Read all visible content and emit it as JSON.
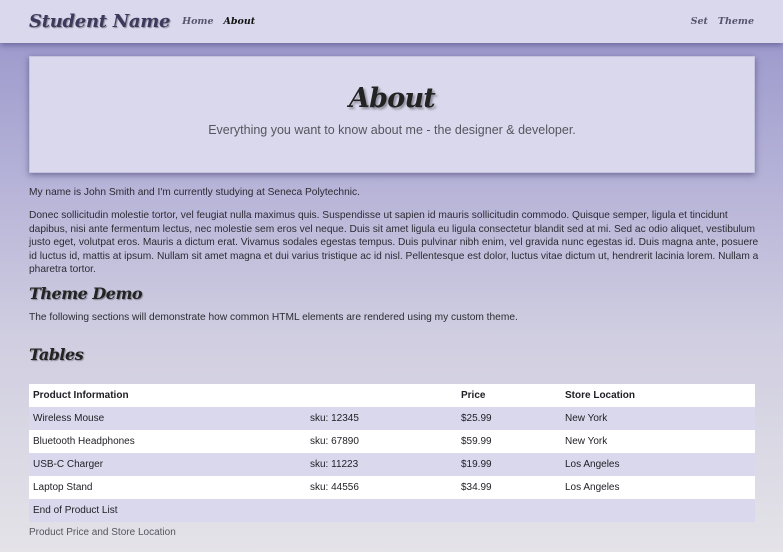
{
  "navbar": {
    "brand": "Student Name",
    "links": [
      {
        "label": "Home",
        "active": false
      },
      {
        "label": "About",
        "active": true
      }
    ],
    "right_links": [
      {
        "label": "Set"
      },
      {
        "label": "Theme"
      }
    ]
  },
  "jumbotron": {
    "title": "About",
    "lead": "Everything you want to know about me - the designer & developer."
  },
  "content": {
    "intro": "My name is John Smith and I'm currently studying at Seneca Polytechnic.",
    "paragraph": "Donec sollicitudin molestie tortor, vel feugiat nulla maximus quis. Suspendisse ut sapien id mauris sollicitudin commodo. Quisque semper, ligula et tincidunt dapibus, nisi ante fermentum lectus, nec molestie sem eros vel neque. Duis sit amet ligula eu ligula consectetur blandit sed at mi. Sed ac odio aliquet, vestibulum justo eget, volutpat eros. Mauris a dictum erat. Vivamus sodales egestas tempus. Duis pulvinar nibh enim, vel gravida nunc egestas id. Duis magna ante, posuere id luctus id, mattis at ipsum. Nullam sit amet magna et dui varius tristique ac id nisl. Pellentesque est dolor, luctus vitae dictum ut, hendrerit lacinia lorem. Nullam a pharetra tortor.",
    "theme_heading": "Theme Demo",
    "theme_desc": "The following sections will demonstrate how common HTML elements are rendered using my custom theme.",
    "tables_heading": "Tables"
  },
  "table": {
    "headers": [
      "Product Information",
      "",
      "Price",
      "Store Location"
    ],
    "rows": [
      [
        "Wireless Mouse",
        "sku: 12345",
        "$25.99",
        "New York"
      ],
      [
        "Bluetooth Headphones",
        "sku: 67890",
        "$59.99",
        "New York"
      ],
      [
        "USB-C Charger",
        "sku: 11223",
        "$19.99",
        "Los Angeles"
      ],
      [
        "Laptop Stand",
        "sku: 44556",
        "$34.99",
        "Los Angeles"
      ]
    ],
    "footer": "End of Product List",
    "caption": "Product Price and Store Location"
  },
  "colors": {
    "navbar_bg": "#dad8ec",
    "stripe": "#dad8ec",
    "gradient_top": "#9793c9",
    "gradient_bottom": "#e4e3e8"
  }
}
